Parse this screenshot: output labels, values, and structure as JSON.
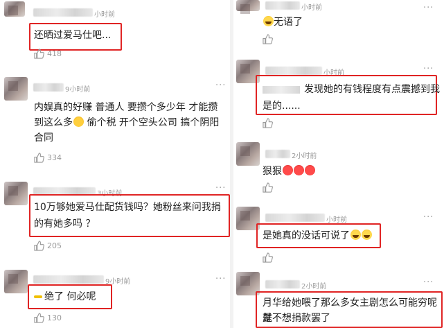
{
  "left_column": [
    {
      "time": "小时前",
      "text_lines": [
        "还晒过爱马仕吧..."
      ],
      "likes": "418"
    },
    {
      "time": "9小时前",
      "text_lines": [
        "内娱真的好赚 普通人 要攒个多少年 才能攒",
        "到这么多",
        " 偷个税 开个空头公司 搞个阴阳",
        "合同"
      ],
      "likes": "334"
    },
    {
      "time": "3小时前",
      "text_lines": [
        "10万够她爱马仕配货钱吗？她粉丝来问我捐",
        "的有她多吗 ？"
      ],
      "likes": "205"
    },
    {
      "time": "9小时前",
      "text_lines": [
        "绝了 何必呢"
      ],
      "likes": "130"
    }
  ],
  "right_column": [
    {
      "time": "小时前",
      "text_lines": [
        "无语了"
      ],
      "likes": ""
    },
    {
      "time": "小时前",
      "text_lines": [
        "发现她的有钱程度有点震撼到我",
        "是的......"
      ],
      "likes": ""
    },
    {
      "time": "2小时前",
      "text_lines": [
        "狠狠"
      ],
      "likes": ""
    },
    {
      "time": "小时前",
      "text_lines": [
        "是她真的没话可说了"
      ],
      "likes": ""
    },
    {
      "time": "2小时前",
      "text_lines": [
        "月华给她喂了那么多女主剧怎么可能穷呢 就",
        "是不想捐款罢了"
      ],
      "likes": ""
    }
  ],
  "more_glyph": "···",
  "icons": {
    "like": "thumbs-up-icon",
    "more": "more-dots-icon"
  },
  "colors": {
    "highlight_box": "#e02424",
    "meta_text": "#9a9a9a",
    "body_text": "#222222",
    "divider": "#f2f2f2"
  }
}
